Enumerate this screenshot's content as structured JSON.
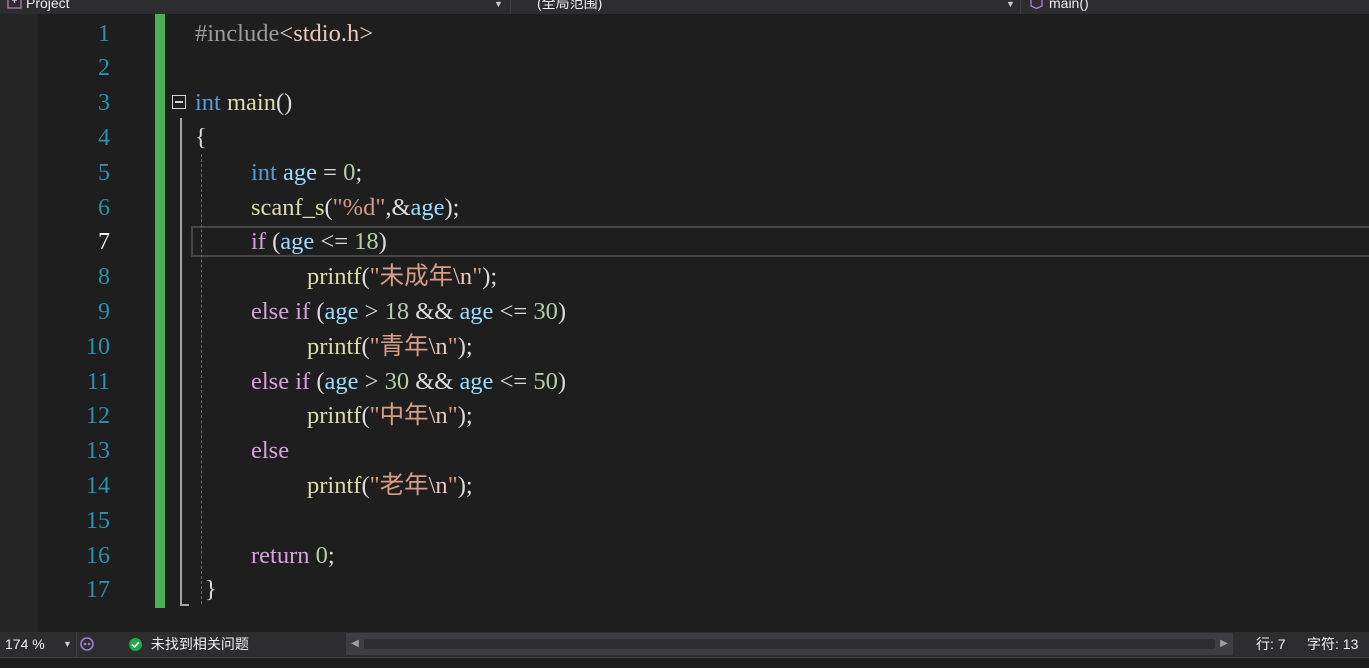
{
  "navbar": {
    "project_label": "Project",
    "scope_label": "(全局范围)",
    "member_label": "main()"
  },
  "editor": {
    "current_line": 7,
    "line_numbers": [
      "1",
      "2",
      "3",
      "4",
      "5",
      "6",
      "7",
      "8",
      "9",
      "10",
      "11",
      "12",
      "13",
      "14",
      "15",
      "16",
      "17"
    ],
    "code": {
      "l1_pp": "#include",
      "l1_inc": "<stdio.h>",
      "l3_type": "int",
      "l3_fn": "main",
      "l3_paren": "()",
      "l4": "{",
      "l5_type": "int",
      "l5_var": "age",
      "l5_eq": " = ",
      "l5_num": "0",
      "l5_semi": ";",
      "l6_fn": "scanf_s",
      "l6_open": "(",
      "l6_str": "\"%d\"",
      "l6_comma": ",&",
      "l6_var": "age",
      "l6_close": ");",
      "l7_kw": "if",
      "l7_open": " (",
      "l7_var": "age",
      "l7_op": " <= ",
      "l7_num": "18",
      "l7_close": ")",
      "l8_fn": "printf",
      "l8_open": "(",
      "l8_str1": "\"未成年",
      "l8_esc": "\\n",
      "l8_str2": "\"",
      "l8_close": ");",
      "l9_kw1": "else",
      "l9_kw2": "if",
      "l9_open": " (",
      "l9_var1": "age",
      "l9_op1": " > ",
      "l9_num1": "18",
      "l9_and": " && ",
      "l9_var2": "age",
      "l9_op2": " <= ",
      "l9_num2": "30",
      "l9_close": ")",
      "l10_fn": "printf",
      "l10_open": "(",
      "l10_str1": "\"青年",
      "l10_esc": "\\n",
      "l10_str2": "\"",
      "l10_close": ");",
      "l11_kw1": "else",
      "l11_kw2": "if",
      "l11_open": " (",
      "l11_var1": "age",
      "l11_op1": " > ",
      "l11_num1": "30",
      "l11_and": " && ",
      "l11_var2": "age",
      "l11_op2": " <= ",
      "l11_num2": "50",
      "l11_close": ")",
      "l12_fn": "printf",
      "l12_open": "(",
      "l12_str1": "\"中年",
      "l12_esc": "\\n",
      "l12_str2": "\"",
      "l12_close": ");",
      "l13_kw": "else",
      "l14_fn": "printf",
      "l14_open": "(",
      "l14_str1": "\"老年",
      "l14_esc": "\\n",
      "l14_str2": "\"",
      "l14_close": ");",
      "l16_kw": "return",
      "l16_num": "0",
      "l16_semi": ";",
      "l17": "}"
    }
  },
  "statusbar": {
    "zoom": "174 %",
    "issues": "未找到相关问题",
    "line_label": "行: 7",
    "char_label": "字符: 13"
  },
  "colors": {
    "background": "#1e1e1e",
    "change_bar": "#4cb050",
    "line_number": "#2b91af",
    "keyword": "#569cd6",
    "control_keyword": "#d8a0df",
    "variable": "#9cdcfe",
    "function": "#dcdcaa",
    "string": "#d69d85",
    "number": "#b5cea8",
    "status_ok": "#1ea84a"
  }
}
